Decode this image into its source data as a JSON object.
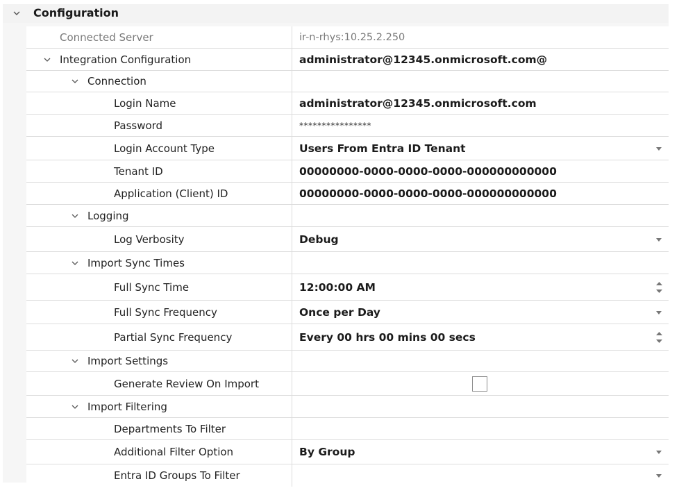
{
  "category": {
    "title": "Configuration"
  },
  "rows": [
    {
      "label": "Connected Server",
      "value": "ir-n-rhys:10.25.2.250"
    },
    {
      "label": "Integration Configuration",
      "value": "administrator@12345.onmicrosoft.com@"
    },
    {
      "label": "Connection"
    },
    {
      "label": "Login Name",
      "value": "administrator@12345.onmicrosoft.com"
    },
    {
      "label": "Password",
      "value": "****************"
    },
    {
      "label": "Login Account Type",
      "value": "Users From Entra ID Tenant"
    },
    {
      "label": "Tenant ID",
      "value": "00000000-0000-0000-0000-000000000000"
    },
    {
      "label": "Application (Client) ID",
      "value": "00000000-0000-0000-0000-000000000000"
    },
    {
      "label": "Logging"
    },
    {
      "label": "Log Verbosity",
      "value": "Debug"
    },
    {
      "label": "Import Sync Times"
    },
    {
      "label": "Full Sync Time",
      "value": "12:00:00 AM"
    },
    {
      "label": "Full Sync Frequency",
      "value": "Once per Day"
    },
    {
      "label": "Partial Sync Frequency",
      "value": "Every 00 hrs 00 mins 00 secs"
    },
    {
      "label": "Import Settings"
    },
    {
      "label": "Generate Review On Import",
      "checked": false
    },
    {
      "label": "Import Filtering"
    },
    {
      "label": "Departments To Filter"
    },
    {
      "label": "Additional Filter Option",
      "value": "By Group"
    },
    {
      "label": "Entra ID Groups To Filter"
    }
  ],
  "icons": {
    "expand": "chevron-down-icon",
    "dropdown": "dropdown-arrow-icon",
    "spinner": "spinner-arrows-icon",
    "checkbox": "checkbox-icon"
  },
  "colors": {
    "grid_background": "#f6f6f6",
    "row_background": "#ffffff",
    "row_border": "#dcdcdc",
    "readonly_text": "#7a7a7a"
  }
}
